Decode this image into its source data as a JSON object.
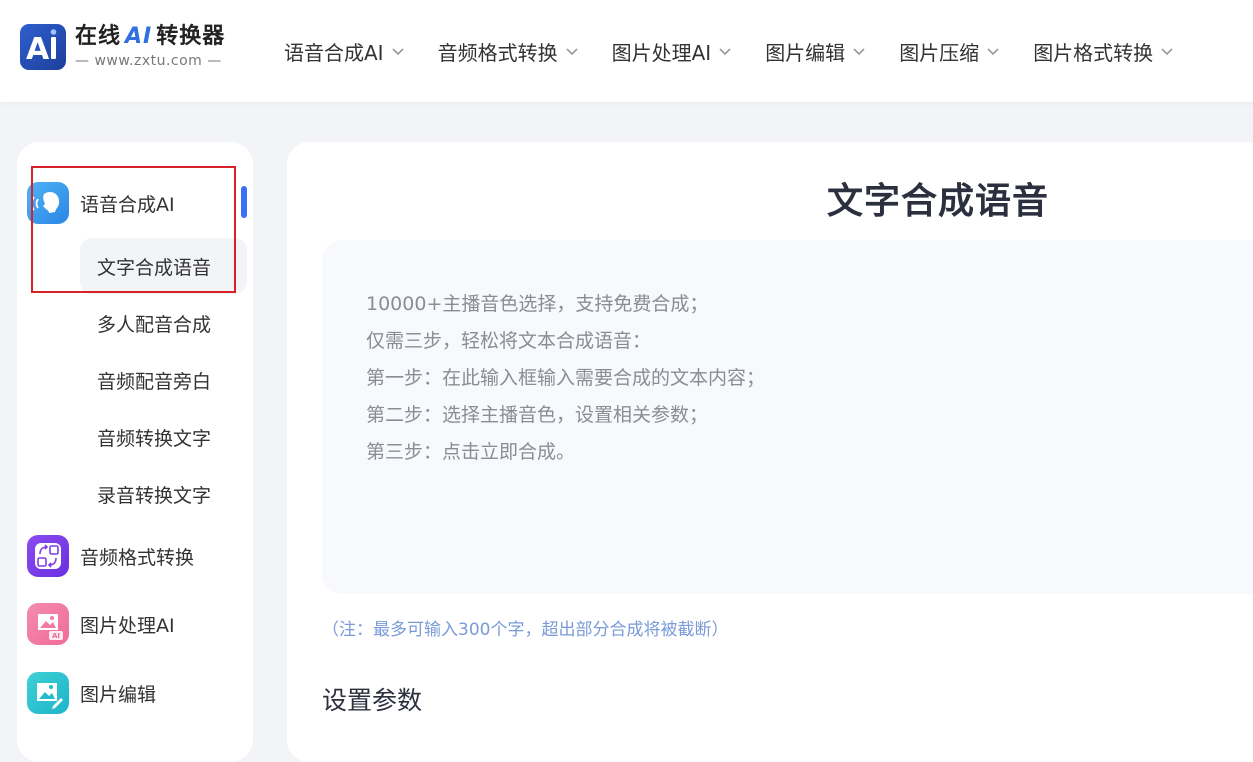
{
  "header": {
    "logo": {
      "title_pre": "在线",
      "title_ai": "AI",
      "title_post": "转换器",
      "subtitle": "— www.zxtu.com —"
    },
    "nav": [
      {
        "label": "语音合成AI"
      },
      {
        "label": "音频格式转换"
      },
      {
        "label": "图片处理AI"
      },
      {
        "label": "图片编辑"
      },
      {
        "label": "图片压缩"
      },
      {
        "label": "图片格式转换"
      }
    ]
  },
  "sidebar": {
    "groups": [
      {
        "label": "语音合成AI",
        "icon": "speech-voice-icon"
      },
      {
        "label": "音频格式转换",
        "icon": "audio-convert-icon"
      },
      {
        "label": "图片处理AI",
        "icon": "image-ai-icon"
      },
      {
        "label": "图片编辑",
        "icon": "image-edit-icon"
      }
    ],
    "subitems": [
      {
        "label": "文字合成语音",
        "active": true
      },
      {
        "label": "多人配音合成"
      },
      {
        "label": "音频配音旁白"
      },
      {
        "label": "音频转换文字"
      },
      {
        "label": "录音转换文字"
      }
    ]
  },
  "main": {
    "title": "文字合成语音",
    "placeholder_lines": [
      "10000+主播音色选择，支持免费合成；",
      "仅需三步，轻松将文本合成语音：",
      "第一步：在此输入框输入需要合成的文本内容；",
      "第二步：选择主播音色，设置相关参数；",
      "第三步：点击立即合成。"
    ],
    "note": "（注：最多可输入300个字，超出部分合成将被截断）",
    "settings_title": "设置参数"
  },
  "colors": {
    "accent": "#3b6ff5",
    "highlight": "#d9212a",
    "note": "#7a9bd8"
  }
}
